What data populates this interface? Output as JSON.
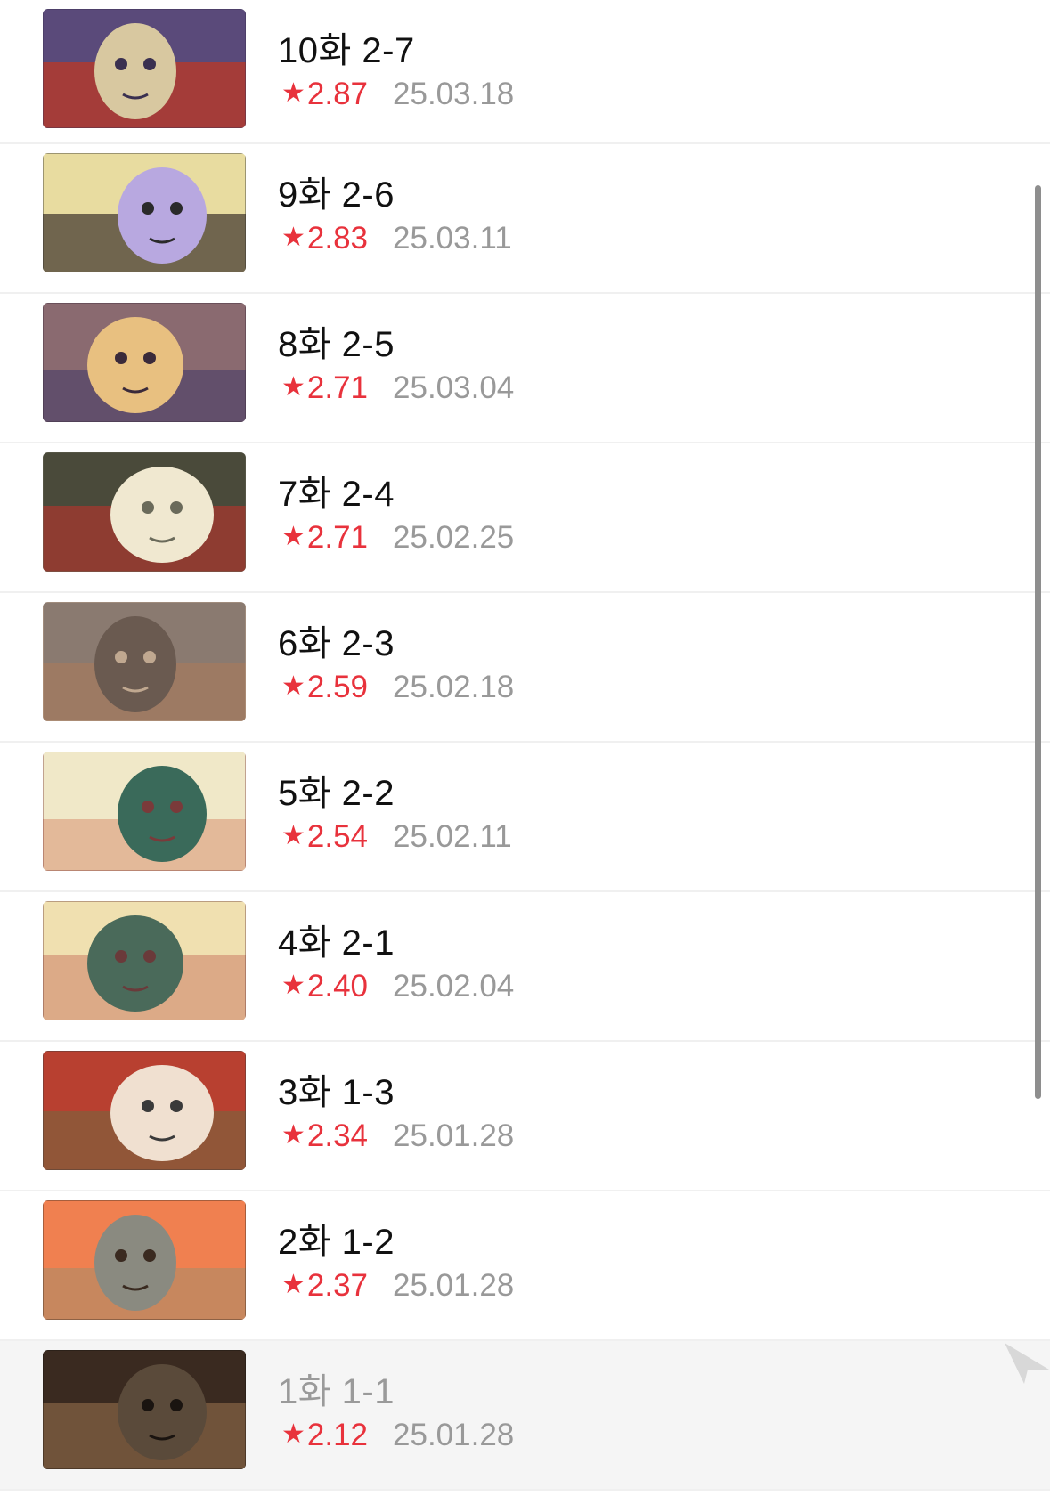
{
  "episodes": [
    {
      "title": "10화 2-7",
      "rating": "2.87",
      "date": "25.03.18",
      "read": false,
      "palette": [
        "#5a4a7a",
        "#b23a2e",
        "#d8c8a0",
        "#3a3050"
      ]
    },
    {
      "title": "9화 2-6",
      "rating": "2.83",
      "date": "25.03.11",
      "read": false,
      "palette": [
        "#e8dca0",
        "#5a5040",
        "#b8a8e0",
        "#2a2a2a"
      ]
    },
    {
      "title": "8화 2-5",
      "rating": "2.71",
      "date": "25.03.04",
      "read": false,
      "palette": [
        "#8a6a70",
        "#5a4a6a",
        "#e8c080",
        "#3a2a3a"
      ]
    },
    {
      "title": "7화 2-4",
      "rating": "2.71",
      "date": "25.02.25",
      "read": false,
      "palette": [
        "#4a4a3a",
        "#9a3a30",
        "#f0e8d0",
        "#6a6a5a"
      ]
    },
    {
      "title": "6화 2-3",
      "rating": "2.59",
      "date": "25.02.18",
      "read": false,
      "palette": [
        "#8a7a70",
        "#a07a60",
        "#6a5a50",
        "#c0a890"
      ]
    },
    {
      "title": "5화 2-2",
      "rating": "2.54",
      "date": "25.02.11",
      "read": false,
      "palette": [
        "#f0e8c8",
        "#e0b090",
        "#3a6a5a",
        "#7a3a3a"
      ]
    },
    {
      "title": "4화 2-1",
      "rating": "2.40",
      "date": "25.02.04",
      "read": false,
      "palette": [
        "#f0e0b0",
        "#d8a080",
        "#4a6a5a",
        "#6a3a3a"
      ]
    },
    {
      "title": "3화 1-3",
      "rating": "2.34",
      "date": "25.01.28",
      "read": false,
      "palette": [
        "#b84030",
        "#8a5a3a",
        "#f0e0d0",
        "#3a3a3a"
      ]
    },
    {
      "title": "2화 1-2",
      "rating": "2.37",
      "date": "25.01.28",
      "read": false,
      "palette": [
        "#f08050",
        "#c08860",
        "#8a8a80",
        "#3a2a20"
      ]
    },
    {
      "title": "1화 1-1",
      "rating": "2.12",
      "date": "25.01.28",
      "read": true,
      "palette": [
        "#3a2a20",
        "#7a5a40",
        "#5a4a3a",
        "#1a1410"
      ]
    }
  ],
  "colors": {
    "rating": "#e8323c",
    "date": "#999999",
    "title": "#111111",
    "read_title": "#9a9a9a"
  },
  "icons": {
    "star": "star-icon"
  }
}
